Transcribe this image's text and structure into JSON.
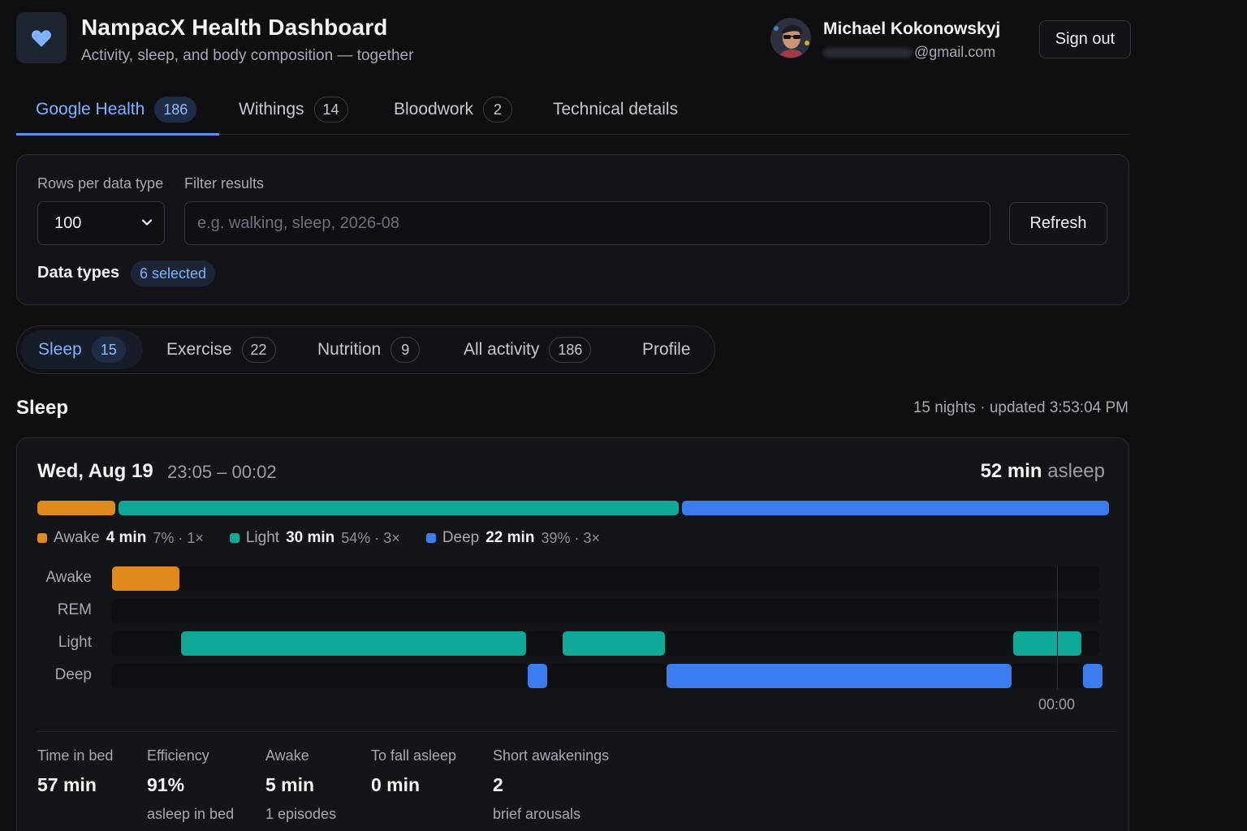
{
  "app": {
    "title": "NampacX Health Dashboard",
    "subtitle": "Activity, sleep, and body composition — together",
    "logo_icon": "heart-icon",
    "accent": "#5b8ff0"
  },
  "user": {
    "name": "Michael Kokonowskyj",
    "email_domain": "@gmail.com",
    "sign_out_label": "Sign out"
  },
  "tabs": [
    {
      "label": "Google Health",
      "count": "186",
      "active": true
    },
    {
      "label": "Withings",
      "count": "14",
      "active": false
    },
    {
      "label": "Bloodwork",
      "count": "2",
      "active": false
    },
    {
      "label": "Technical details",
      "count": null,
      "active": false
    }
  ],
  "filters": {
    "rows_label": "Rows per data type",
    "rows_value": "100",
    "filter_label": "Filter results",
    "filter_placeholder": "e.g. walking, sleep, 2026-08",
    "refresh_label": "Refresh",
    "data_types_label": "Data types",
    "data_types_badge": "6 selected"
  },
  "subtabs": [
    {
      "label": "Sleep",
      "count": "15",
      "active": true
    },
    {
      "label": "Exercise",
      "count": "22",
      "active": false
    },
    {
      "label": "Nutrition",
      "count": "9",
      "active": false
    },
    {
      "label": "All activity",
      "count": "186",
      "active": false
    },
    {
      "label": "Profile",
      "count": null,
      "active": false
    }
  ],
  "section": {
    "title": "Sleep",
    "meta": "15 nights · updated 3:53:04 PM"
  },
  "night": {
    "date": "Wed, Aug 19",
    "time_range": "23:05 – 00:02",
    "asleep_value": "52 min",
    "asleep_suffix": "asleep",
    "stage_colors": {
      "awake": "#e08a1e",
      "light": "#10a896",
      "deep": "#3b7cf0"
    },
    "summary_segments": [
      {
        "stage": "awake",
        "fraction": 0.073
      },
      {
        "stage": "light",
        "fraction": 0.526
      },
      {
        "stage": "deep",
        "fraction": 0.401
      }
    ],
    "legend": [
      {
        "stage": "awake",
        "name": "Awake",
        "value": "4 min",
        "detail": "7% · 1×"
      },
      {
        "stage": "light",
        "name": "Light",
        "value": "30 min",
        "detail": "54% · 3×"
      },
      {
        "stage": "deep",
        "name": "Deep",
        "value": "22 min",
        "detail": "39% · 3×"
      }
    ],
    "timeline": {
      "start": "23:05",
      "end": "00:02",
      "tick_label": "00:00",
      "rows": [
        {
          "stage": "awake",
          "label": "Awake",
          "segments": [
            [
              "23:05",
              "23:09"
            ]
          ]
        },
        {
          "stage": "rem",
          "label": "REM",
          "segments": []
        },
        {
          "stage": "light",
          "label": "Light",
          "segments": [
            [
              "23:09",
              "23:29"
            ],
            [
              "23:31",
              "23:37"
            ],
            [
              "23:57",
              "00:01"
            ]
          ]
        },
        {
          "stage": "deep",
          "label": "Deep",
          "segments": [
            [
              "23:29",
              "23:30"
            ],
            [
              "23:37",
              "23:57"
            ],
            [
              "00:01",
              "00:02"
            ]
          ]
        }
      ]
    },
    "stats": [
      {
        "label": "Time in bed",
        "value": "57 min",
        "sub": ""
      },
      {
        "label": "Efficiency",
        "value": "91%",
        "sub": "asleep in bed"
      },
      {
        "label": "Awake",
        "value": "5 min",
        "sub": "1 episodes"
      },
      {
        "label": "To fall asleep",
        "value": "0 min",
        "sub": ""
      },
      {
        "label": "Short awakenings",
        "value": "2",
        "sub": "brief arousals"
      }
    ]
  }
}
